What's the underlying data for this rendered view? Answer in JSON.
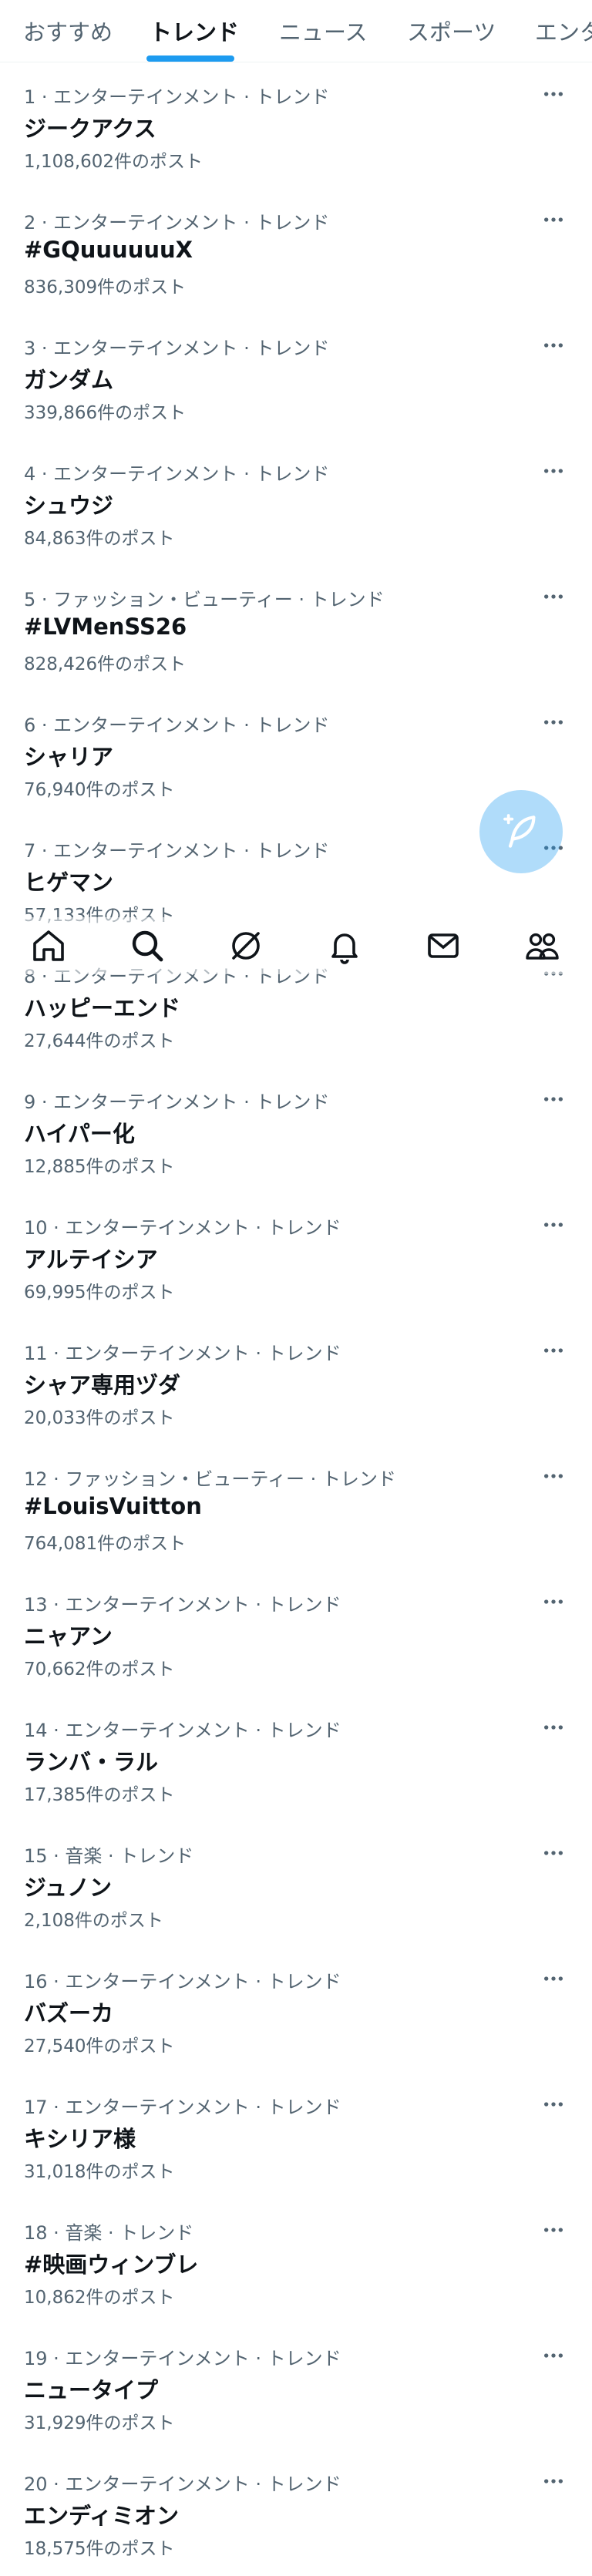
{
  "tabs": [
    {
      "label": "おすすめ",
      "active": false
    },
    {
      "label": "トレンド",
      "active": true
    },
    {
      "label": "ニュース",
      "active": false
    },
    {
      "label": "スポーツ",
      "active": false
    },
    {
      "label": "エンタ",
      "active": false
    }
  ],
  "accent_color": "#1d9bf0",
  "trends": [
    {
      "meta": "1 · エンターテインメント · トレンド",
      "name": "ジークアクス",
      "count": "1,108,602件のポスト"
    },
    {
      "meta": "2 · エンターテインメント · トレンド",
      "name": "#GQuuuuuuX",
      "count": "836,309件のポスト"
    },
    {
      "meta": "3 · エンターテインメント · トレンド",
      "name": "ガンダム",
      "count": "339,866件のポスト"
    },
    {
      "meta": "4 · エンターテインメント · トレンド",
      "name": "シュウジ",
      "count": "84,863件のポスト"
    },
    {
      "meta": "5 · ファッション・ビューティー · トレンド",
      "name": "#LVMenSS26",
      "count": "828,426件のポスト"
    },
    {
      "meta": "6 · エンターテインメント · トレンド",
      "name": "シャリア",
      "count": "76,940件のポスト"
    },
    {
      "meta": "7 · エンターテインメント · トレンド",
      "name": "ヒゲマン",
      "count": "57,133件のポスト"
    },
    {
      "meta": "8 · エンターテインメント · トレンド",
      "name": "ハッピーエンド",
      "count": "27,644件のポスト"
    },
    {
      "meta": "9 · エンターテインメント · トレンド",
      "name": "ハイパー化",
      "count": "12,885件のポスト"
    },
    {
      "meta": "10 · エンターテインメント · トレンド",
      "name": "アルテイシア",
      "count": "69,995件のポスト"
    },
    {
      "meta": "11 · エンターテインメント · トレンド",
      "name": "シャア専用ヅダ",
      "count": "20,033件のポスト"
    },
    {
      "meta": "12 · ファッション・ビューティー · トレンド",
      "name": "#LouisVuitton",
      "count": "764,081件のポスト"
    },
    {
      "meta": "13 · エンターテインメント · トレンド",
      "name": "ニャアン",
      "count": "70,662件のポスト"
    },
    {
      "meta": "14 · エンターテインメント · トレンド",
      "name": "ランバ・ラル",
      "count": "17,385件のポスト"
    },
    {
      "meta": "15 · 音楽 · トレンド",
      "name": "ジュノン",
      "count": "2,108件のポスト"
    },
    {
      "meta": "16 · エンターテインメント · トレンド",
      "name": "バズーカ",
      "count": "27,540件のポスト"
    },
    {
      "meta": "17 · エンターテインメント · トレンド",
      "name": "キシリア様",
      "count": "31,018件のポスト"
    },
    {
      "meta": "18 · 音楽 · トレンド",
      "name": "#映画ウィンブレ",
      "count": "10,862件のポスト"
    },
    {
      "meta": "19 · エンターテインメント · トレンド",
      "name": "ニュータイプ",
      "count": "31,929件のポスト"
    },
    {
      "meta": "20 · エンターテインメント · トレンド",
      "name": "エンディミオン",
      "count": "18,575件のポスト"
    }
  ],
  "trend_menu_icon": "more-horizontal-icon",
  "bottom_nav": [
    {
      "icon": "home-icon"
    },
    {
      "icon": "search-icon"
    },
    {
      "icon": "grok-icon"
    },
    {
      "icon": "bell-icon"
    },
    {
      "icon": "mail-icon"
    },
    {
      "icon": "communities-icon"
    }
  ],
  "compose_icon": "compose-feather-icon"
}
